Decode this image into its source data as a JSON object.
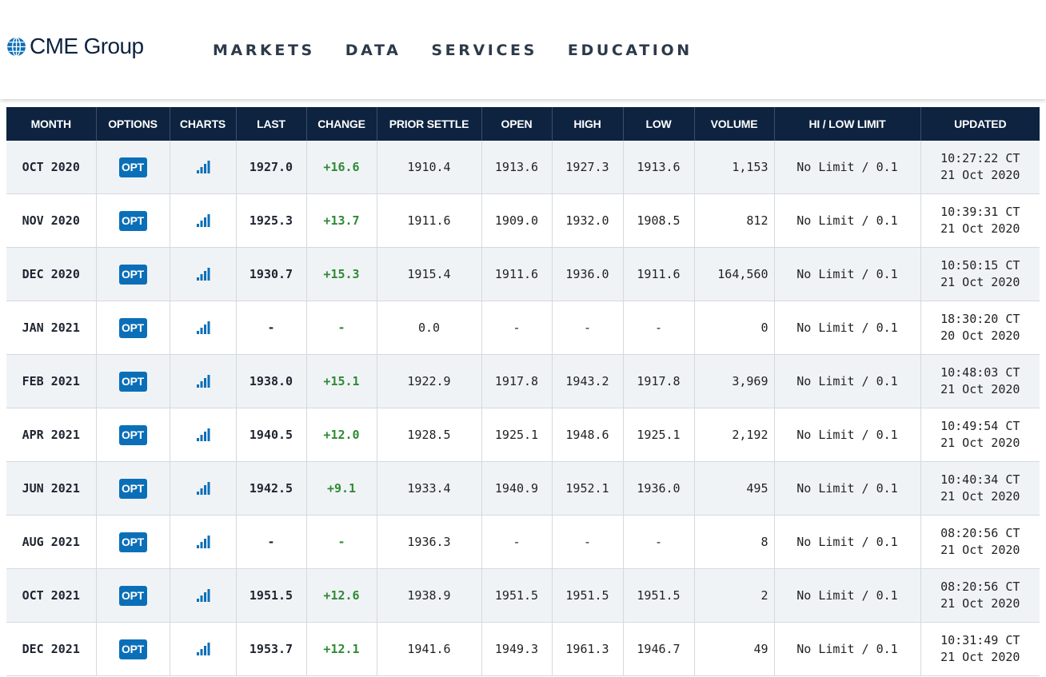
{
  "brand": {
    "name": "CME Group",
    "accent": "#0b6fb8",
    "navy": "#0d2340",
    "positive": "#2e8b34"
  },
  "nav": {
    "items": [
      {
        "label": "MARKETS"
      },
      {
        "label": "DATA"
      },
      {
        "label": "SERVICES"
      },
      {
        "label": "EDUCATION"
      }
    ]
  },
  "table": {
    "headers": [
      "MONTH",
      "OPTIONS",
      "CHARTS",
      "LAST",
      "CHANGE",
      "PRIOR SETTLE",
      "OPEN",
      "HIGH",
      "LOW",
      "VOLUME",
      "HI / LOW LIMIT",
      "UPDATED"
    ],
    "option_label": "OPT",
    "chart_icon": "bar-chart-icon",
    "rows": [
      {
        "month": "OCT 2020",
        "last": "1927.0",
        "change": "+16.6",
        "prior_settle": "1910.4",
        "open": "1913.6",
        "high": "1927.3",
        "low": "1913.6",
        "volume": "1,153",
        "limit": "No Limit / 0.1",
        "updated_time": "10:27:22 CT",
        "updated_date": "21 Oct 2020"
      },
      {
        "month": "NOV 2020",
        "last": "1925.3",
        "change": "+13.7",
        "prior_settle": "1911.6",
        "open": "1909.0",
        "high": "1932.0",
        "low": "1908.5",
        "volume": "812",
        "limit": "No Limit / 0.1",
        "updated_time": "10:39:31 CT",
        "updated_date": "21 Oct 2020"
      },
      {
        "month": "DEC 2020",
        "last": "1930.7",
        "change": "+15.3",
        "prior_settle": "1915.4",
        "open": "1911.6",
        "high": "1936.0",
        "low": "1911.6",
        "volume": "164,560",
        "limit": "No Limit / 0.1",
        "updated_time": "10:50:15 CT",
        "updated_date": "21 Oct 2020"
      },
      {
        "month": "JAN 2021",
        "last": "-",
        "change": "-",
        "prior_settle": "0.0",
        "open": "-",
        "high": "-",
        "low": "-",
        "volume": "0",
        "limit": "No Limit / 0.1",
        "updated_time": "18:30:20 CT",
        "updated_date": "20 Oct 2020"
      },
      {
        "month": "FEB 2021",
        "last": "1938.0",
        "change": "+15.1",
        "prior_settle": "1922.9",
        "open": "1917.8",
        "high": "1943.2",
        "low": "1917.8",
        "volume": "3,969",
        "limit": "No Limit / 0.1",
        "updated_time": "10:48:03 CT",
        "updated_date": "21 Oct 2020"
      },
      {
        "month": "APR 2021",
        "last": "1940.5",
        "change": "+12.0",
        "prior_settle": "1928.5",
        "open": "1925.1",
        "high": "1948.6",
        "low": "1925.1",
        "volume": "2,192",
        "limit": "No Limit / 0.1",
        "updated_time": "10:49:54 CT",
        "updated_date": "21 Oct 2020"
      },
      {
        "month": "JUN 2021",
        "last": "1942.5",
        "change": "+9.1",
        "prior_settle": "1933.4",
        "open": "1940.9",
        "high": "1952.1",
        "low": "1936.0",
        "volume": "495",
        "limit": "No Limit / 0.1",
        "updated_time": "10:40:34 CT",
        "updated_date": "21 Oct 2020"
      },
      {
        "month": "AUG 2021",
        "last": "-",
        "change": "-",
        "prior_settle": "1936.3",
        "open": "-",
        "high": "-",
        "low": "-",
        "volume": "8",
        "limit": "No Limit / 0.1",
        "updated_time": "08:20:56 CT",
        "updated_date": "21 Oct 2020"
      },
      {
        "month": "OCT 2021",
        "last": "1951.5",
        "change": "+12.6",
        "prior_settle": "1938.9",
        "open": "1951.5",
        "high": "1951.5",
        "low": "1951.5",
        "volume": "2",
        "limit": "No Limit / 0.1",
        "updated_time": "08:20:56 CT",
        "updated_date": "21 Oct 2020"
      },
      {
        "month": "DEC 2021",
        "last": "1953.7",
        "change": "+12.1",
        "prior_settle": "1941.6",
        "open": "1949.3",
        "high": "1961.3",
        "low": "1946.7",
        "volume": "49",
        "limit": "No Limit / 0.1",
        "updated_time": "10:31:49 CT",
        "updated_date": "21 Oct 2020"
      }
    ]
  }
}
